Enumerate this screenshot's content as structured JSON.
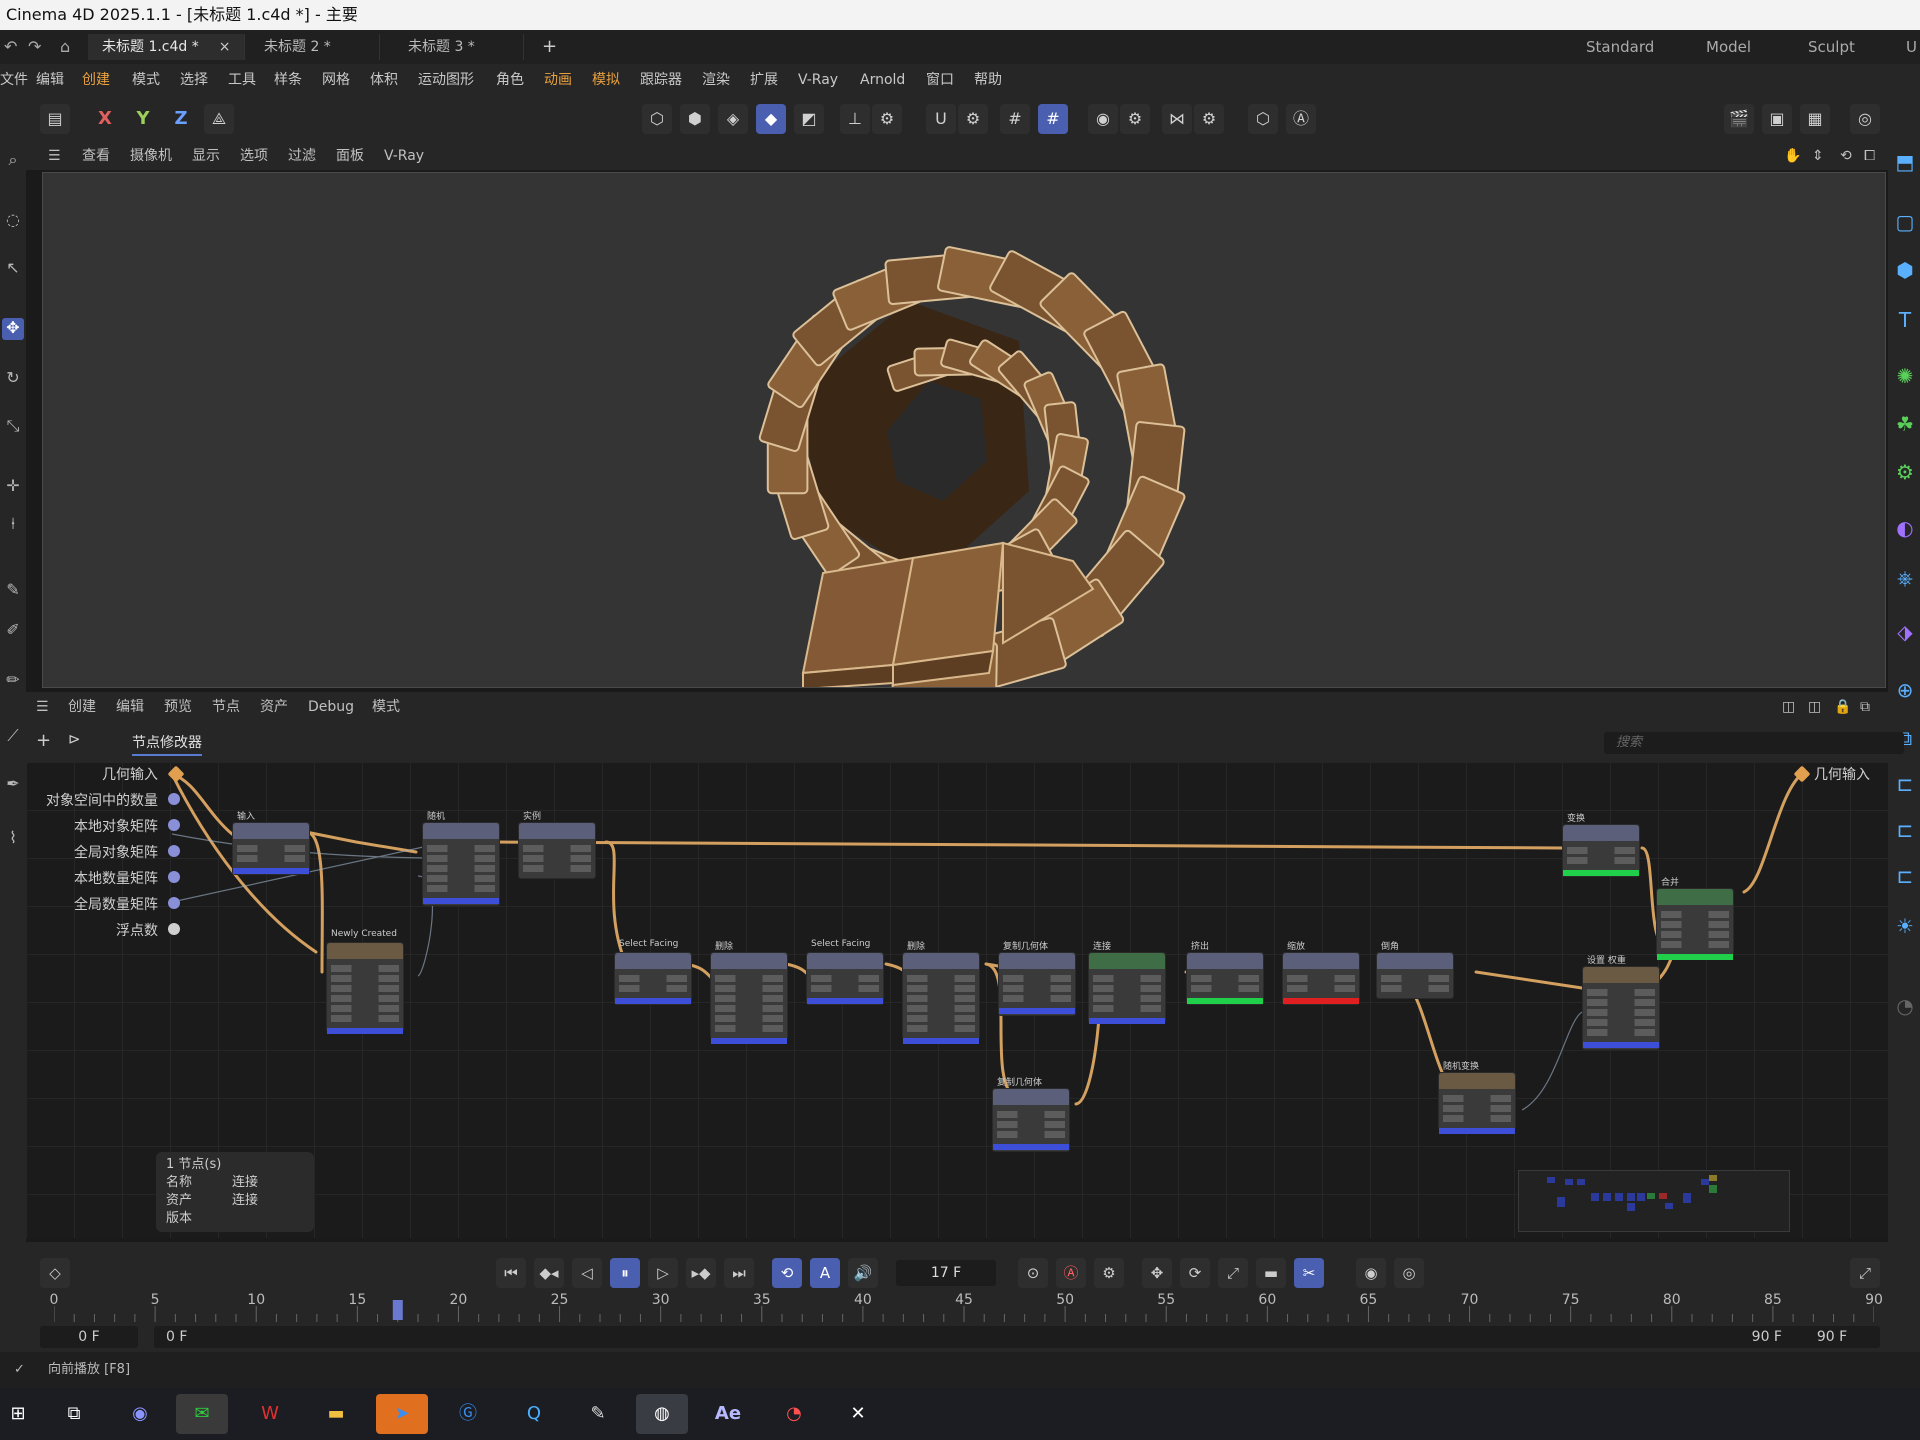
{
  "window": {
    "title": "Cinema 4D 2025.1.1 - [未标题 1.c4d *] - 主要"
  },
  "doc_tabs": [
    {
      "label": "未标题 1.c4d *",
      "close": "×"
    },
    {
      "label": "未标题 2 *"
    },
    {
      "label": "未标题 3 *"
    }
  ],
  "add_tab": "+",
  "layout_tabs": [
    "Standard",
    "Model",
    "Sculpt",
    "U"
  ],
  "menu": [
    "文件",
    "编辑",
    "创建",
    "模式",
    "选择",
    "工具",
    "样条",
    "网格",
    "体积",
    "运动图形",
    "角色",
    "动画",
    "模拟",
    "跟踪器",
    "渲染",
    "扩展",
    "V-Ray",
    "Arnold",
    "窗口",
    "帮助"
  ],
  "axes": {
    "x": "X",
    "y": "Y",
    "z": "Z"
  },
  "viewport_menu": [
    "查看",
    "摄像机",
    "显示",
    "选项",
    "过滤",
    "面板",
    "V-Ray"
  ],
  "node_editor": {
    "menu": [
      "创建",
      "编辑",
      "预览",
      "节点",
      "资产",
      "Debug",
      "模式"
    ],
    "tab": "节点修改器",
    "search_placeholder": "搜索",
    "inputs": [
      "几何输入",
      "对象空间中的数量",
      "本地对象矩阵",
      "全局对象矩阵",
      "本地数量矩阵",
      "全局数量矩阵",
      "浮点数"
    ],
    "output": "几何输入",
    "node_titles": {
      "n1": "输入",
      "n2": "随机",
      "n3": "实例",
      "n4": "Newly Created",
      "n5": "Select Facing",
      "n6": "删除",
      "n7": "Select Facing",
      "n8": "删除",
      "n9": "复制几何体",
      "n10": "连接",
      "n11": "挤出",
      "n12": "缩放",
      "n13": "倒角",
      "n14": "复制几何体",
      "n15": "变换",
      "n16": "设置 权重",
      "n17": "随机变换",
      "n18": "合并"
    },
    "info": {
      "count": "1 节点(s)",
      "rows": [
        {
          "key": "名称",
          "value": "连接"
        },
        {
          "key": "资产",
          "value": "连接"
        },
        {
          "key": "版本",
          "value": ""
        }
      ]
    }
  },
  "timeline": {
    "current_frame": "17 F",
    "ticks": [
      "0",
      "5",
      "10",
      "15",
      "20",
      "25",
      "30",
      "35",
      "40",
      "45",
      "50",
      "55",
      "60",
      "65",
      "70",
      "75",
      "80",
      "85",
      "90"
    ],
    "start": "0 F",
    "range_start": "0 F",
    "range_end": "90 F",
    "end": "90 F",
    "playhead_frame": 17
  },
  "status": {
    "text": "向前播放 [F8]"
  },
  "taskbar": [
    "start-icon",
    "task-view-icon",
    "discord-icon",
    "wechat-icon",
    "wps-icon",
    "file-explorer-icon",
    "feishu-icon",
    "browser-icon",
    "qq-icon",
    "notes-icon",
    "cinema4d-icon",
    "after-effects-icon",
    "recorder-icon",
    "capcut-icon"
  ],
  "taskbar_labels": {
    "ae": "Ae"
  },
  "colors": {
    "accent": "#4a5fb0",
    "wood": "#8a6340",
    "wire": "#d4a060"
  }
}
